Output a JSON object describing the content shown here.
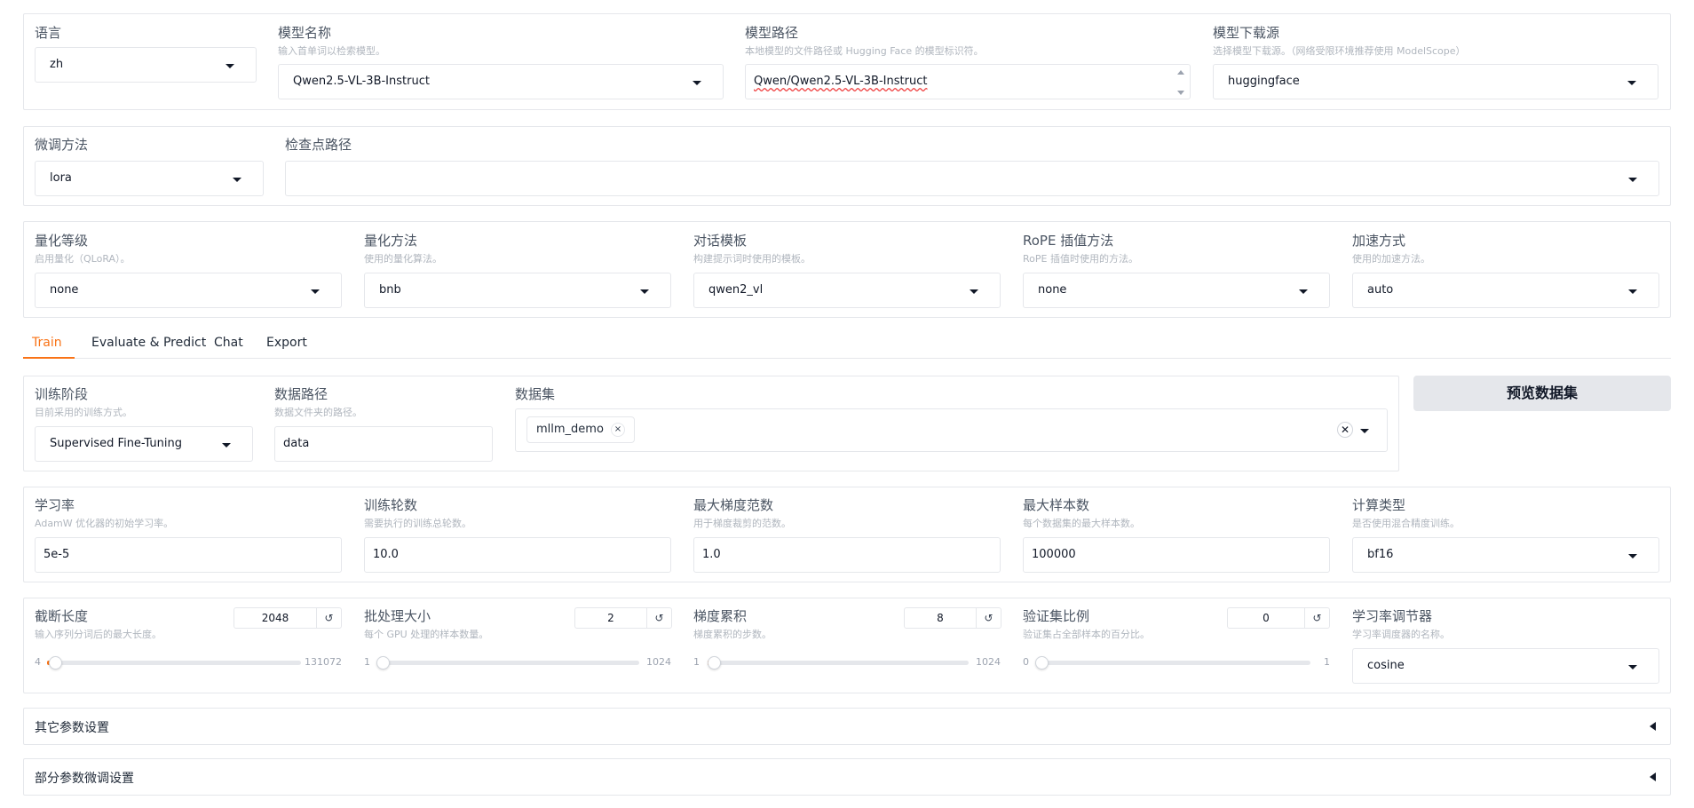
{
  "colors": {
    "accent": "#f97316",
    "border": "#e5e7eb",
    "button_bg": "#e5e7eb"
  },
  "top": {
    "lang": {
      "label": "语言",
      "value": "zh"
    },
    "model_name": {
      "label": "模型名称",
      "info": "输入首单词以检索模型。",
      "value": "Qwen2.5-VL-3B-Instruct"
    },
    "model_path": {
      "label": "模型路径",
      "info": "本地模型的文件路径或 Hugging Face 的模型标识符。",
      "value": "Qwen/Qwen2.5-VL-3B-Instruct"
    },
    "hub": {
      "label": "模型下载源",
      "info": "选择模型下载源。（网络受限环境推荐使用 ModelScope）",
      "value": "huggingface"
    }
  },
  "finetune": {
    "method": {
      "label": "微调方法",
      "value": "lora"
    },
    "checkpoint": {
      "label": "检查点路径",
      "value": ""
    }
  },
  "advanced": {
    "quant_bit": {
      "label": "量化等级",
      "info": "启用量化（QLoRA）。",
      "value": "none"
    },
    "quant_method": {
      "label": "量化方法",
      "info": "使用的量化算法。",
      "value": "bnb"
    },
    "template": {
      "label": "对话模板",
      "info": "构建提示词时使用的模板。",
      "value": "qwen2_vl"
    },
    "rope": {
      "label": "RoPE 插值方法",
      "info": "RoPE 插值时使用的方法。",
      "value": "none"
    },
    "booster": {
      "label": "加速方式",
      "info": "使用的加速方法。",
      "value": "auto"
    }
  },
  "tabs": [
    "Train",
    "Evaluate & Predict",
    "Chat",
    "Export"
  ],
  "train": {
    "stage": {
      "label": "训练阶段",
      "info": "目前采用的训练方式。",
      "value": "Supervised Fine-Tuning"
    },
    "dataset_dir": {
      "label": "数据路径",
      "info": "数据文件夹的路径。",
      "value": "data"
    },
    "dataset": {
      "label": "数据集",
      "chips": [
        "mllm_demo"
      ]
    },
    "preview_button": "预览数据集",
    "lr": {
      "label": "学习率",
      "info": "AdamW 优化器的初始学习率。",
      "value": "5e-5"
    },
    "epochs": {
      "label": "训练轮数",
      "info": "需要执行的训练总轮数。",
      "value": "10.0"
    },
    "max_grad_norm": {
      "label": "最大梯度范数",
      "info": "用于梯度裁剪的范数。",
      "value": "1.0"
    },
    "max_samples": {
      "label": "最大样本数",
      "info": "每个数据集的最大样本数。",
      "value": "100000"
    },
    "compute_type": {
      "label": "计算类型",
      "info": "是否使用混合精度训练。",
      "value": "bf16"
    },
    "cutoff_len": {
      "label": "截断长度",
      "info": "输入序列分词后的最大长度。",
      "value": "2048",
      "min": "4",
      "max": "131072",
      "fraction": 0.0156
    },
    "batch_size": {
      "label": "批处理大小",
      "info": "每个 GPU 处理的样本数量。",
      "value": "2",
      "min": "1",
      "max": "1024",
      "fraction": 0.001
    },
    "grad_accum": {
      "label": "梯度累积",
      "info": "梯度累积的步数。",
      "value": "8",
      "min": "1",
      "max": "1024",
      "fraction": 0.0068
    },
    "val_size": {
      "label": "验证集比例",
      "info": "验证集占全部样本的百分比。",
      "value": "0",
      "min": "0",
      "max": "1",
      "fraction": 0.0
    },
    "scheduler": {
      "label": "学习率调节器",
      "info": "学习率调度器的名称。",
      "value": "cosine"
    }
  },
  "accordions": [
    "其它参数设置",
    "部分参数微调设置"
  ],
  "icons": {
    "reset": "↺",
    "remove": "×",
    "clear": "✕"
  }
}
